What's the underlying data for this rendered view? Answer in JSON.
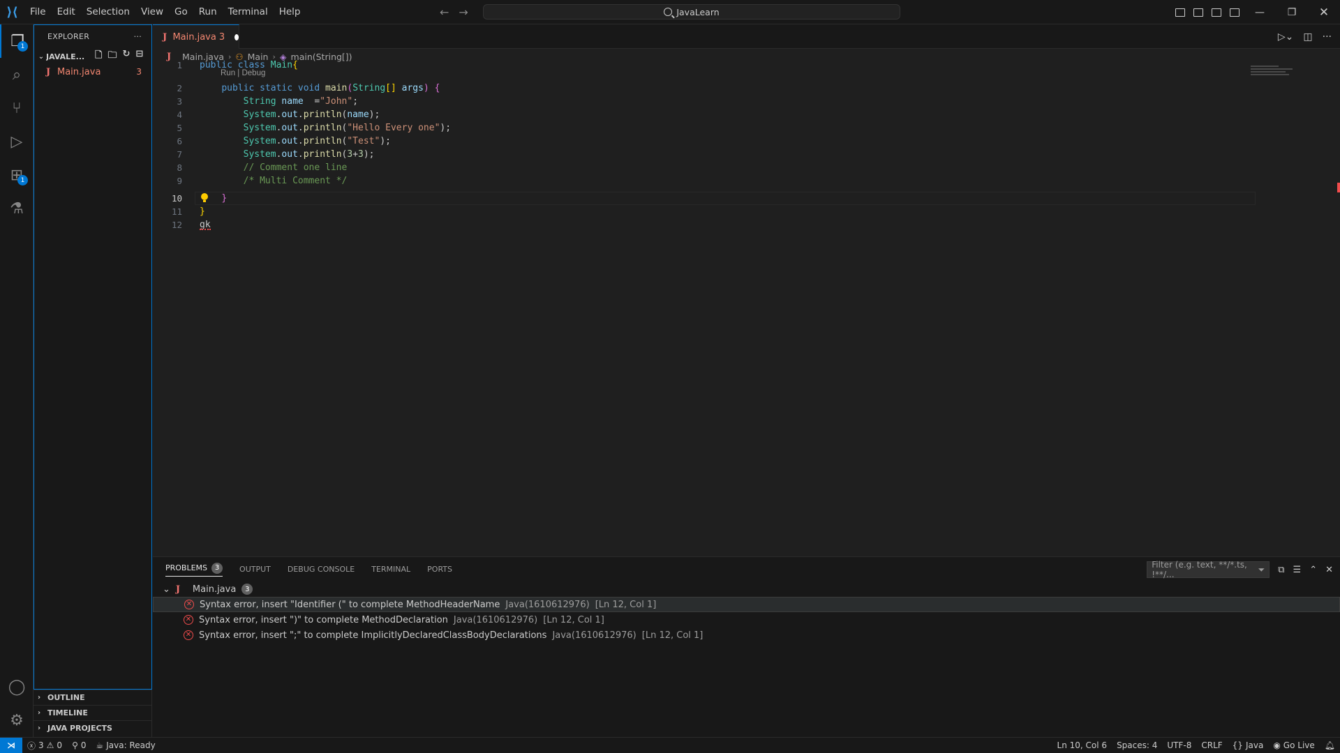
{
  "menu": [
    "File",
    "Edit",
    "Selection",
    "View",
    "Go",
    "Run",
    "Terminal",
    "Help"
  ],
  "command_center": {
    "label": "JavaLearn"
  },
  "sidebar": {
    "title": "EXPLORER",
    "more": "···",
    "folder": "JAVALE...",
    "files": [
      {
        "name": "Main.java",
        "problems": "3"
      }
    ],
    "sections": [
      "OUTLINE",
      "TIMELINE",
      "JAVA PROJECTS"
    ]
  },
  "activity_badges": {
    "explorer": "1",
    "extensions": "1"
  },
  "tab": {
    "label": "Main.java",
    "problems": "3"
  },
  "breadcrumb": {
    "file": "Main.java",
    "class": "Main",
    "method": "main(String[])"
  },
  "code": {
    "line_numbers": [
      "1",
      "2",
      "3",
      "4",
      "5",
      "6",
      "7",
      "8",
      "9",
      "10",
      "11",
      "12"
    ],
    "codelens": "Run | Debug"
  },
  "panel": {
    "tabs": [
      "PROBLEMS",
      "OUTPUT",
      "DEBUG CONSOLE",
      "TERMINAL",
      "PORTS"
    ],
    "problems_count": "3",
    "filter_placeholder": "Filter (e.g. text, **/*.ts, !**/...",
    "file": "Main.java",
    "file_count": "3",
    "items": [
      {
        "message": "Syntax error, insert \"Identifier (\" to complete MethodHeaderName",
        "source": "Java(1610612976)",
        "location": "[Ln 12, Col 1]"
      },
      {
        "message": "Syntax error, insert \")\" to complete MethodDeclaration",
        "source": "Java(1610612976)",
        "location": "[Ln 12, Col 1]"
      },
      {
        "message": "Syntax error, insert \";\" to complete ImplicitlyDeclaredClassBodyDeclarations",
        "source": "Java(1610612976)",
        "location": "[Ln 12, Col 1]"
      }
    ]
  },
  "status": {
    "errors": "3",
    "warnings": "0",
    "ports": "0",
    "java": "Java: Ready",
    "position": "Ln 10, Col 6",
    "spaces": "Spaces: 4",
    "encoding": "UTF-8",
    "eol": "CRLF",
    "language": "Java",
    "golive": "Go Live"
  },
  "colors": {
    "accent": "#0078d4",
    "error": "#f14c4c",
    "file_error": "#f48771"
  }
}
